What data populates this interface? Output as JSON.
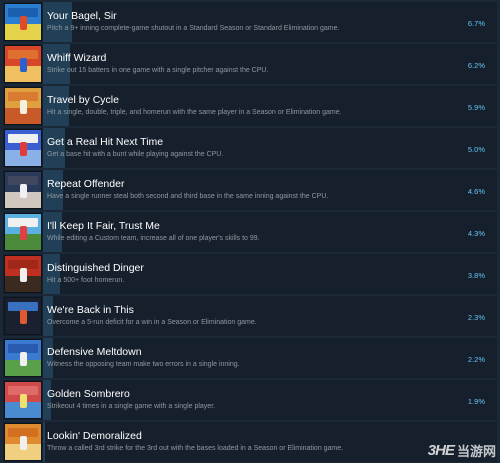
{
  "achievements": [
    {
      "title": "Your Bagel, Sir",
      "desc": "Pitch a 9+ inning complete-game shutout in a Standard Season or Standard Elimination game.",
      "percent": "6.7%",
      "value": 6.7,
      "colors": {
        "sky": "#2a7fd2",
        "ground": "#e4d34a",
        "fig": "#e04a2a",
        "banner": "#1a5fb0"
      }
    },
    {
      "title": "Whiff Wizard",
      "desc": "Strike out 15 batters in one game with a single pitcher against the CPU.",
      "percent": "6.2%",
      "value": 6.2,
      "colors": {
        "sky": "#d8462a",
        "ground": "#f0c060",
        "fig": "#2a60d0",
        "banner": "#e07030"
      }
    },
    {
      "title": "Travel by Cycle",
      "desc": "Hit a single, double, triple, and homerun with the same player in a Season or Elimination game.",
      "percent": "5.9%",
      "value": 5.9,
      "colors": {
        "sky": "#e0a040",
        "ground": "#c85a2a",
        "fig": "#f4f0e0",
        "banner": "#d87a30"
      }
    },
    {
      "title": "Get a Real Hit Next Time",
      "desc": "Get a base hit with a bunt while playing against the CPU.",
      "percent": "5.0%",
      "value": 5.0,
      "colors": {
        "sky": "#3a5fd0",
        "ground": "#8ab0e8",
        "fig": "#e03a3a",
        "banner": "#f0f0f0"
      }
    },
    {
      "title": "Repeat Offender",
      "desc": "Have a single runner steal both second and third base in the same inning against the CPU.",
      "percent": "4.6%",
      "value": 4.6,
      "colors": {
        "sky": "#2a3a5a",
        "ground": "#d0c8c0",
        "fig": "#f0f0f0",
        "banner": "#404860"
      }
    },
    {
      "title": "I'll Keep It Fair, Trust Me",
      "desc": "While editing a Custom team, increase all of one player's skills to 99.",
      "percent": "4.3%",
      "value": 4.3,
      "colors": {
        "sky": "#5ab0e0",
        "ground": "#4a8a3a",
        "fig": "#e04040",
        "banner": "#f0f0f0"
      }
    },
    {
      "title": "Distinguished Dinger",
      "desc": "Hit a 500+ foot homerun.",
      "percent": "3.8%",
      "value": 3.8,
      "colors": {
        "sky": "#c03020",
        "ground": "#3a2a20",
        "fig": "#f0f0f0",
        "banner": "#a02818"
      }
    },
    {
      "title": "We're Back in This",
      "desc": "Overcome a 5-run deficit for a win in a Season or Elimination game.",
      "percent": "2.3%",
      "value": 2.3,
      "colors": {
        "sky": "#1a2030",
        "ground": "#1a2030",
        "fig": "#e05a30",
        "banner": "#3a70c0"
      }
    },
    {
      "title": "Defensive Meltdown",
      "desc": "Witness the opposing team make two errors in a single inning.",
      "percent": "2.2%",
      "value": 2.2,
      "colors": {
        "sky": "#3a7ad0",
        "ground": "#5aa04a",
        "fig": "#f0f0f0",
        "banner": "#2a5ab0"
      }
    },
    {
      "title": "Golden Sombrero",
      "desc": "Strikeout 4 times in a single game with a single player.",
      "percent": "1.9%",
      "value": 1.9,
      "colors": {
        "sky": "#d04a4a",
        "ground": "#4a8ad0",
        "fig": "#f0e070",
        "banner": "#e06a6a"
      }
    },
    {
      "title": "Lookin' Demoralized",
      "desc": "Throw a called 3rd strike for the 3rd out with the bases loaded in a Season or Elimination game.",
      "percent": "",
      "value": null,
      "colors": {
        "sky": "#e08a30",
        "ground": "#f0d080",
        "fig": "#f0f0f0",
        "banner": "#d07020"
      }
    }
  ],
  "watermark": {
    "logo": "3HE",
    "text": "当游网"
  }
}
